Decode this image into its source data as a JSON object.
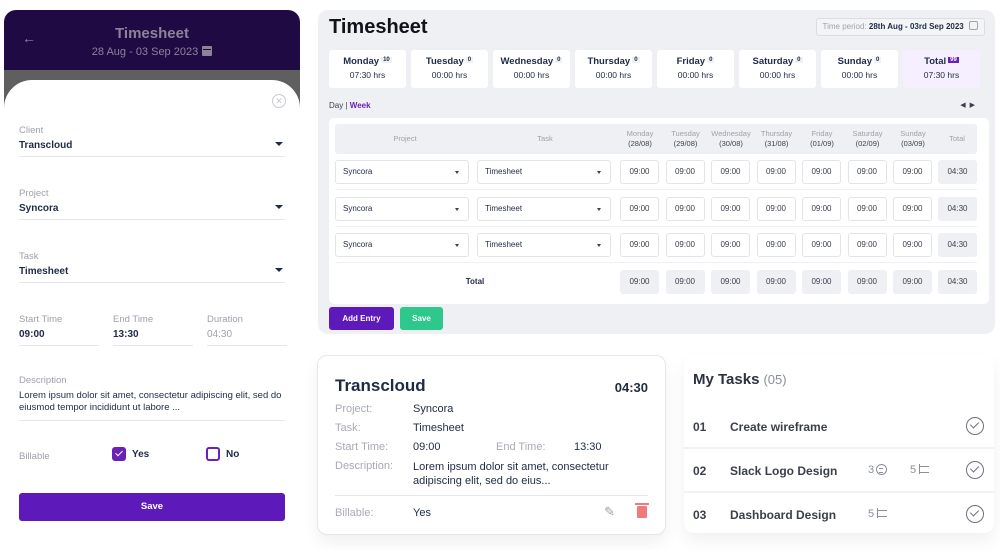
{
  "mobile": {
    "back_icon": "arrow-left-icon",
    "title": "Timesheet",
    "date_range": "28 Aug - 03 Sep 2023",
    "calendar_icon": "calendar-icon",
    "close_icon": "close-circle-icon",
    "client": {
      "label": "Client",
      "value": "Transcloud"
    },
    "project": {
      "label": "Project",
      "value": "Syncora"
    },
    "task": {
      "label": "Task",
      "value": "Timesheet"
    },
    "start_time": {
      "label": "Start Time",
      "value": "09:00"
    },
    "end_time": {
      "label": "End Time",
      "value": "13:30"
    },
    "duration": {
      "label": "Duration",
      "value": "04:30"
    },
    "description": {
      "label": "Description",
      "value": "Lorem ipsum dolor sit amet, consectetur adipiscing elit, sed do eiusmod tempor incididunt ut labore ..."
    },
    "billable": {
      "label": "Billable",
      "yes_label": "Yes",
      "no_label": "No",
      "yes_checked": true,
      "no_checked": false
    },
    "save_label": "Save"
  },
  "timesheet": {
    "title": "Timesheet",
    "period_label": "Time period:",
    "period_value": "28th Aug - 03rd Sep 2023",
    "days": [
      {
        "name": "Monday",
        "badge": "10",
        "hours": "07:30 hrs"
      },
      {
        "name": "Tuesday",
        "badge": "0",
        "hours": "00:00 hrs"
      },
      {
        "name": "Wednesday",
        "badge": "0",
        "hours": "00:00 hrs"
      },
      {
        "name": "Thursday",
        "badge": "0",
        "hours": "00:00 hrs"
      },
      {
        "name": "Friday",
        "badge": "0",
        "hours": "00:00 hrs"
      },
      {
        "name": "Saturday",
        "badge": "0",
        "hours": "00:00 hrs"
      },
      {
        "name": "Sunday",
        "badge": "0",
        "hours": "00:00 hrs"
      },
      {
        "name": "Total",
        "badge": "99",
        "hours": "07:30 hrs"
      }
    ],
    "view_day": "Day",
    "view_sep": "|",
    "view_week": "Week",
    "nav_arrows": "◀ ▶",
    "columns": {
      "project": "Project",
      "task": "Task",
      "days": [
        {
          "name": "Monday",
          "date": "(28/08)"
        },
        {
          "name": "Tuesday",
          "date": "(29/08)"
        },
        {
          "name": "Wednesday",
          "date": "(30/08)"
        },
        {
          "name": "Thursday",
          "date": "(31/08)"
        },
        {
          "name": "Friday",
          "date": "(01/09)"
        },
        {
          "name": "Saturday",
          "date": "(02/09)"
        },
        {
          "name": "Sunday",
          "date": "(03/09)"
        }
      ],
      "total": "Total"
    },
    "rows": [
      {
        "project": "Syncora",
        "task": "Timesheet",
        "values": [
          "09:00",
          "09:00",
          "09:00",
          "09:00",
          "09:00",
          "09:00",
          "09:00"
        ],
        "total": "04:30"
      },
      {
        "project": "Syncora",
        "task": "Timesheet",
        "values": [
          "09:00",
          "09:00",
          "09:00",
          "09:00",
          "09:00",
          "09:00",
          "09:00"
        ],
        "total": "04:30"
      },
      {
        "project": "Syncora",
        "task": "Timesheet",
        "values": [
          "09:00",
          "09:00",
          "09:00",
          "09:00",
          "09:00",
          "09:00",
          "09:00"
        ],
        "total": "04:30"
      }
    ],
    "totals_row": {
      "label": "Total",
      "values": [
        "09:00",
        "09:00",
        "09:00",
        "09:00",
        "09:00",
        "09:00",
        "09:00"
      ],
      "total": "04:30"
    },
    "add_entry_label": "Add Entry",
    "save_label": "Save"
  },
  "entry_card": {
    "client": "Transcloud",
    "duration": "04:30",
    "project_label": "Project:",
    "project": "Syncora",
    "task_label": "Task:",
    "task": "Timesheet",
    "start_label": "Start Time:",
    "start": "09:00",
    "end_label": "End Time:",
    "end": "13:30",
    "description_label": "Description:",
    "description": "Lorem ipsum dolor sit amet, consectetur adipiscing elit, sed do eius...",
    "billable_label": "Billable:",
    "billable": "Yes",
    "edit_icon": "pencil-icon",
    "delete_icon": "trash-icon"
  },
  "my_tasks": {
    "title": "My Tasks",
    "count": "(05)",
    "items": [
      {
        "num": "01",
        "name": "Create wireframe",
        "comments": "",
        "subtasks": ""
      },
      {
        "num": "02",
        "name": "Slack Logo Design",
        "comments": "3",
        "subtasks": "5"
      },
      {
        "num": "03",
        "name": "Dashboard Design",
        "comments": "",
        "subtasks": "5"
      }
    ]
  },
  "colors": {
    "brand_purple": "#5d19b9",
    "header_dark": "#200a44",
    "save_green": "#2ec88d",
    "delete_red": "#f07a7a"
  }
}
